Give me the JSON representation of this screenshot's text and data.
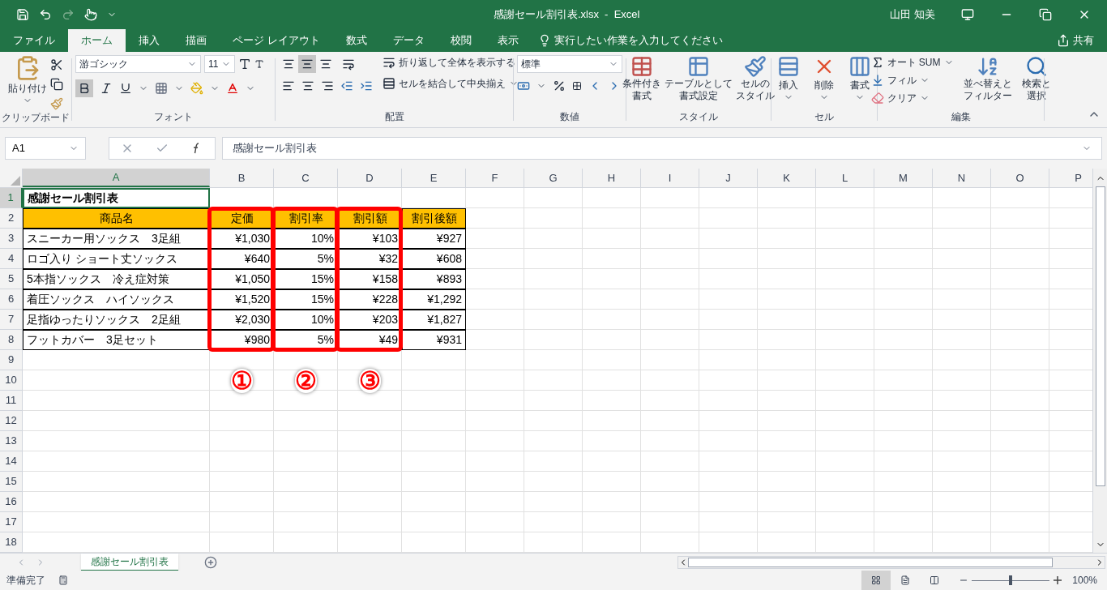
{
  "title_bar": {
    "title": "感謝セール割引表.xlsx  -  Excel",
    "user": "山田 知美"
  },
  "ribbon_tabs": [
    {
      "label": "ファイル",
      "selected": false
    },
    {
      "label": "ホーム",
      "selected": true
    },
    {
      "label": "挿入",
      "selected": false
    },
    {
      "label": "描画",
      "selected": false
    },
    {
      "label": "ページ レイアウト",
      "selected": false
    },
    {
      "label": "数式",
      "selected": false
    },
    {
      "label": "データ",
      "selected": false
    },
    {
      "label": "校閲",
      "selected": false
    },
    {
      "label": "表示",
      "selected": false
    }
  ],
  "tell_me": "実行したい作業を入力してください",
  "share": "共有",
  "ribbon": {
    "clipboard": {
      "paste": "貼り付け",
      "label": "クリップボード"
    },
    "font": {
      "font_name": "游ゴシック",
      "font_size": "11",
      "bold": true,
      "label": "フォント"
    },
    "alignment": {
      "middle": true,
      "wrap": "折り返して全体を表示する",
      "merge": "セルを結合して中央揃え",
      "label": "配置"
    },
    "number": {
      "format": "標準",
      "label": "数値"
    },
    "styles": {
      "buttons": [
        {
          "lines": [
            "条件付き",
            "書式"
          ]
        },
        {
          "lines": [
            "テーブルとして",
            "書式設定"
          ]
        },
        {
          "lines": [
            "セルの",
            "スタイル"
          ]
        }
      ],
      "label": "スタイル"
    },
    "cells": {
      "buttons": [
        "挿入",
        "削除",
        "書式"
      ],
      "label": "セル"
    },
    "editing": {
      "autosum": "オート SUM",
      "fill": "フィル",
      "clear": "クリア",
      "sort": [
        "並べ替えと",
        "フィルター"
      ],
      "find": [
        "検索と",
        "選択"
      ],
      "label": "編集"
    }
  },
  "name_box": "A1",
  "formula": "感謝セール割引表",
  "columns": [
    {
      "label": "A",
      "selected": true
    },
    {
      "label": "B",
      "selected": false
    },
    {
      "label": "C",
      "selected": false
    },
    {
      "label": "D",
      "selected": false
    },
    {
      "label": "E",
      "selected": false
    },
    {
      "label": "F",
      "selected": false
    },
    {
      "label": "G",
      "selected": false
    },
    {
      "label": "H",
      "selected": false
    },
    {
      "label": "I",
      "selected": false
    },
    {
      "label": "J",
      "selected": false
    },
    {
      "label": "K",
      "selected": false
    },
    {
      "label": "L",
      "selected": false
    },
    {
      "label": "M",
      "selected": false
    },
    {
      "label": "N",
      "selected": false
    },
    {
      "label": "O",
      "selected": false
    },
    {
      "label": "P",
      "selected": false
    }
  ],
  "rows": [
    {
      "number": "1",
      "selected": true,
      "kind": "title",
      "cells": [
        "感謝セール割引表"
      ]
    },
    {
      "number": "2",
      "selected": false,
      "kind": "header",
      "cells": [
        "商品名",
        "定価",
        "割引率",
        "割引額",
        "割引後額"
      ]
    },
    {
      "number": "3",
      "selected": false,
      "kind": "data",
      "cells": [
        "スニーカー用ソックス　3足組",
        "¥1,030",
        "10%",
        "¥103",
        "¥927"
      ]
    },
    {
      "number": "4",
      "selected": false,
      "kind": "data",
      "cells": [
        "ロゴ入り ショート丈ソックス",
        "¥640",
        "5%",
        "¥32",
        "¥608"
      ]
    },
    {
      "number": "5",
      "selected": false,
      "kind": "data",
      "cells": [
        "5本指ソックス　冷え症対策",
        "¥1,050",
        "15%",
        "¥158",
        "¥893"
      ]
    },
    {
      "number": "6",
      "selected": false,
      "kind": "data",
      "cells": [
        "着圧ソックス　ハイソックス",
        "¥1,520",
        "15%",
        "¥228",
        "¥1,292"
      ]
    },
    {
      "number": "7",
      "selected": false,
      "kind": "data",
      "cells": [
        "足指ゆったりソックス　2足組",
        "¥2,030",
        "10%",
        "¥203",
        "¥1,827"
      ]
    },
    {
      "number": "8",
      "selected": false,
      "kind": "data",
      "cells": [
        "フットカバー　3足セット",
        "¥980",
        "5%",
        "¥49",
        "¥931"
      ]
    },
    {
      "number": "9",
      "selected": false,
      "kind": "empty"
    },
    {
      "number": "10",
      "selected": false,
      "kind": "empty"
    },
    {
      "number": "11",
      "selected": false,
      "kind": "empty"
    },
    {
      "number": "12",
      "selected": false,
      "kind": "empty"
    },
    {
      "number": "13",
      "selected": false,
      "kind": "empty"
    },
    {
      "number": "14",
      "selected": false,
      "kind": "empty"
    },
    {
      "number": "15",
      "selected": false,
      "kind": "empty"
    },
    {
      "number": "16",
      "selected": false,
      "kind": "empty"
    },
    {
      "number": "17",
      "selected": false,
      "kind": "empty"
    },
    {
      "number": "18",
      "selected": false,
      "kind": "empty"
    }
  ],
  "annotations": [
    {
      "label": "①"
    },
    {
      "label": "②"
    },
    {
      "label": "③"
    }
  ],
  "sheet_tabs": [
    {
      "label": "感謝セール割引表",
      "selected": true
    }
  ],
  "status_bar": {
    "text": "準備完了",
    "views": [
      {
        "selected": true
      },
      {
        "selected": false
      },
      {
        "selected": false
      }
    ],
    "zoom_slider": {
      "level": 0.5
    },
    "zoom": "100%"
  }
}
